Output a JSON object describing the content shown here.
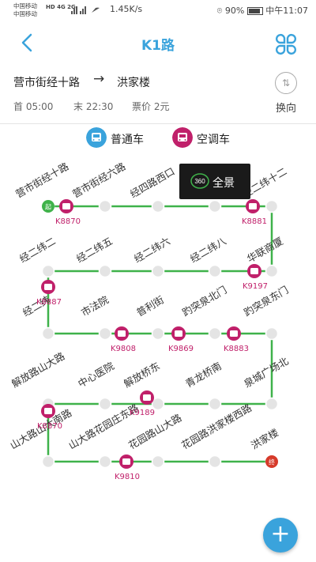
{
  "status_bar": {
    "carrier_1": "中国移动",
    "carrier_2": "中国移动",
    "net_badge": "HD 4G 2G",
    "speed": "1.45K/s",
    "battery": "90%",
    "time": "中午11:07"
  },
  "header": {
    "title": "K1路",
    "back_icon": "chevron-left-icon",
    "menu_icon": "four-petal-icon"
  },
  "route": {
    "from": "营市街经十路",
    "to": "洪家楼",
    "first_label": "首 05:00",
    "last_label": "末 22:30",
    "fare_label": "票价 2元",
    "swap_label": "换向"
  },
  "legend": {
    "normal": "普通车",
    "ac": "空调车",
    "normal_color": "#3aa3dc",
    "ac_color": "#c0206a"
  },
  "toast": {
    "text": "全景",
    "logo": "360"
  },
  "stops": [
    "营市街经十路",
    "营市街经六路",
    "经四路西口",
    "",
    "",
    "经二纬十二",
    "经二纬二",
    "经二纬五",
    "经二纬六",
    "经二纬八",
    "华联商厦",
    "经二纬",
    "市法院",
    "普利街",
    "趵突泉北门",
    "趵突泉东门",
    "解放路山大路",
    "中心医院",
    "解放桥东",
    "青龙桥南",
    "泉城广场北",
    "山大路山大南路",
    "山大路花园庄东路",
    "花园路山大路",
    "花园路洪家楼西路",
    "洪家楼"
  ],
  "start_badge": "起",
  "end_badge": "终",
  "buses": [
    "K8870",
    "K8881",
    "K8887",
    "K9197",
    "K9808",
    "K9869",
    "K8883",
    "K8870",
    "K9189",
    "K9810"
  ],
  "fab_label": "+",
  "line_color": "#3fb24a"
}
